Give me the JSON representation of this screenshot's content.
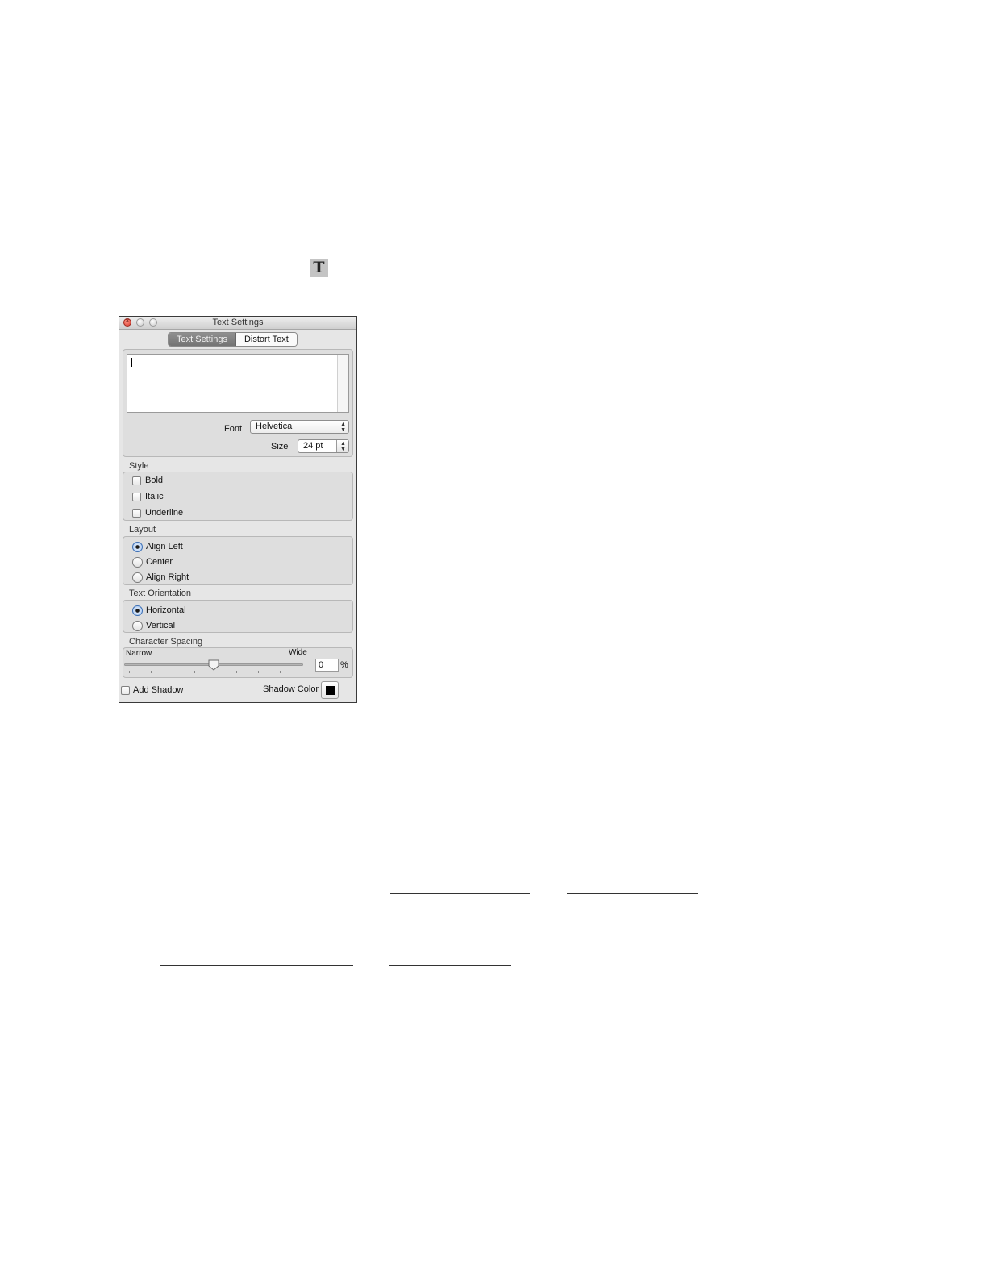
{
  "toolbar_icon": {
    "glyph": "T",
    "icon": "text-tool-icon"
  },
  "window": {
    "title": "Text Settings"
  },
  "tabs": [
    {
      "label": "Text Settings",
      "active": true
    },
    {
      "label": "Distort Text",
      "active": false
    }
  ],
  "text_input": {
    "value": ""
  },
  "font": {
    "label": "Font",
    "value": "Helvetica"
  },
  "size": {
    "label": "Size",
    "value": "24 pt"
  },
  "style": {
    "label": "Style",
    "options": [
      {
        "label": "Bold",
        "checked": false
      },
      {
        "label": "Italic",
        "checked": false
      },
      {
        "label": "Underline",
        "checked": false
      }
    ]
  },
  "layout": {
    "label": "Layout",
    "options": [
      {
        "label": "Align Left",
        "selected": true
      },
      {
        "label": "Center",
        "selected": false
      },
      {
        "label": "Align Right",
        "selected": false
      }
    ]
  },
  "orientation": {
    "label": "Text Orientation",
    "options": [
      {
        "label": "Horizontal",
        "selected": true
      },
      {
        "label": "Vertical",
        "selected": false
      }
    ]
  },
  "spacing": {
    "label": "Character Spacing",
    "min_label": "Narrow",
    "max_label": "Wide",
    "value": "0",
    "unit": "%",
    "slider_fraction": 0.5
  },
  "shadow": {
    "label": "Add Shadow",
    "checked": false,
    "color_label": "Shadow Color",
    "color": "#000000"
  }
}
